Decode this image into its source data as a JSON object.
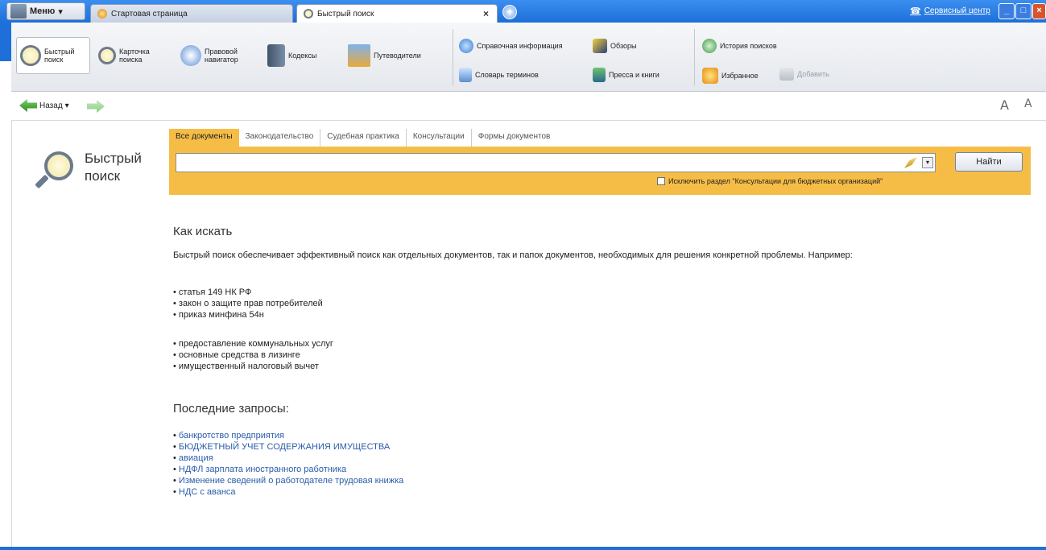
{
  "window": {
    "menu_label": "Меню",
    "tabs": [
      {
        "label": "Стартовая страница",
        "active": false
      },
      {
        "label": "Быстрый поиск",
        "active": true
      }
    ],
    "tab_close": "×",
    "tab_new": "+",
    "service_center": "Сервисный центр",
    "accent_color": "#1e6fd9"
  },
  "toolbar": {
    "quick_search": "Быстрый поиск",
    "search_card": "Карточка поиска",
    "legal_navigator": "Правовой навигатор",
    "codes": "Кодексы",
    "guides": "Путеводители",
    "reference_info": "Справочная информация",
    "reviews": "Обзоры",
    "glossary": "Словарь терминов",
    "press_books": "Пресса и книги",
    "search_history": "История поисков",
    "favorites": "Избранное",
    "add": "Добавить"
  },
  "nav": {
    "back_label": "Назад",
    "back_dropdown": "▾",
    "font_increase": "A",
    "font_decrease": "A"
  },
  "quick_search": {
    "title": "Быстрый поиск",
    "tabs": [
      "Все документы",
      "Законодательство",
      "Судебная практика",
      "Консультации",
      "Формы документов"
    ],
    "active_tab": "Все документы",
    "input_value": "",
    "dropdown_arrow": "▾",
    "find_button": "Найти",
    "exclude_label": "Исключить раздел \"Консультации для бюджетных организаций\"",
    "exclude_checked": false,
    "panel_color": "#f6bd46"
  },
  "how_to": {
    "heading": "Как искать",
    "description": "Быстрый поиск обеспечивает эффективный поиск как отдельных документов, так и папок документов, необходимых для решения конкретной проблемы. Например:",
    "examples_group1": [
      "статья 149 НК РФ",
      "закон о защите прав потребителей",
      "приказ минфина 54н"
    ],
    "examples_group2": [
      "предоставление коммунальных услуг",
      "основные средства в лизинге",
      "имущественный налоговый вычет"
    ]
  },
  "recent": {
    "heading": "Последние запросы:",
    "items": [
      "банкротство предприятия",
      "БЮДЖЕТНЫЙ УЧЕТ СОДЕРЖАНИЯ ИМУЩЕСТВА",
      "авиация",
      "НДФЛ зарплата иностранного работника",
      "Изменение сведений о работодателе трудовая книжка",
      "НДС с аванса"
    ]
  }
}
